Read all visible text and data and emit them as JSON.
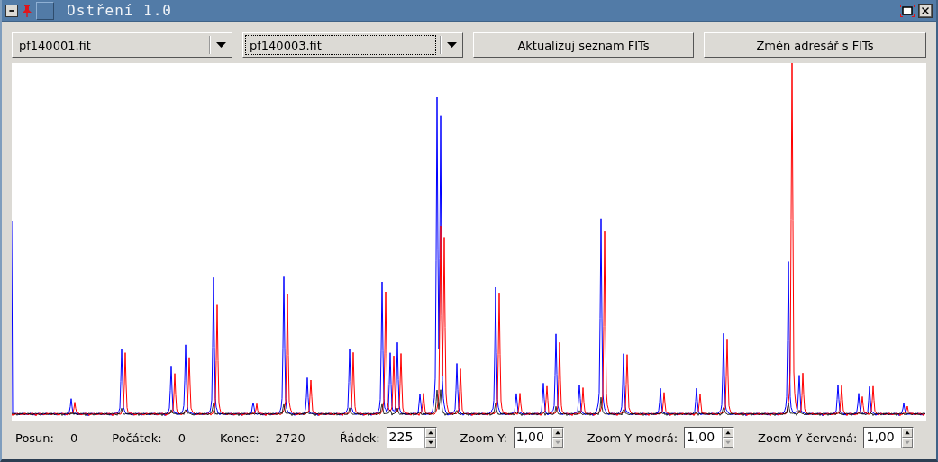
{
  "window": {
    "title": "Ostření 1.0"
  },
  "file_selectors": [
    {
      "value": "pf140001.fit",
      "focused": false
    },
    {
      "value": "pf140003.fit",
      "focused": true
    }
  ],
  "buttons": [
    "Aktualizuj seznam FITs",
    "Změn adresář s FITs"
  ],
  "status": [
    {
      "label": "Posun:",
      "value": "0"
    },
    {
      "label": "Počátek:",
      "value": "0"
    },
    {
      "label": "Konec:",
      "value": "2720"
    }
  ],
  "spinners": [
    {
      "label": "Řádek:",
      "value": "225",
      "down_disabled": false
    },
    {
      "label": "Zoom Y:",
      "value": "1,00",
      "down_disabled": true
    },
    {
      "label": "Zoom Y modrá:",
      "value": "1,00",
      "down_disabled": true
    },
    {
      "label": "Zoom Y červená:",
      "value": "1,00",
      "down_disabled": true
    }
  ]
}
